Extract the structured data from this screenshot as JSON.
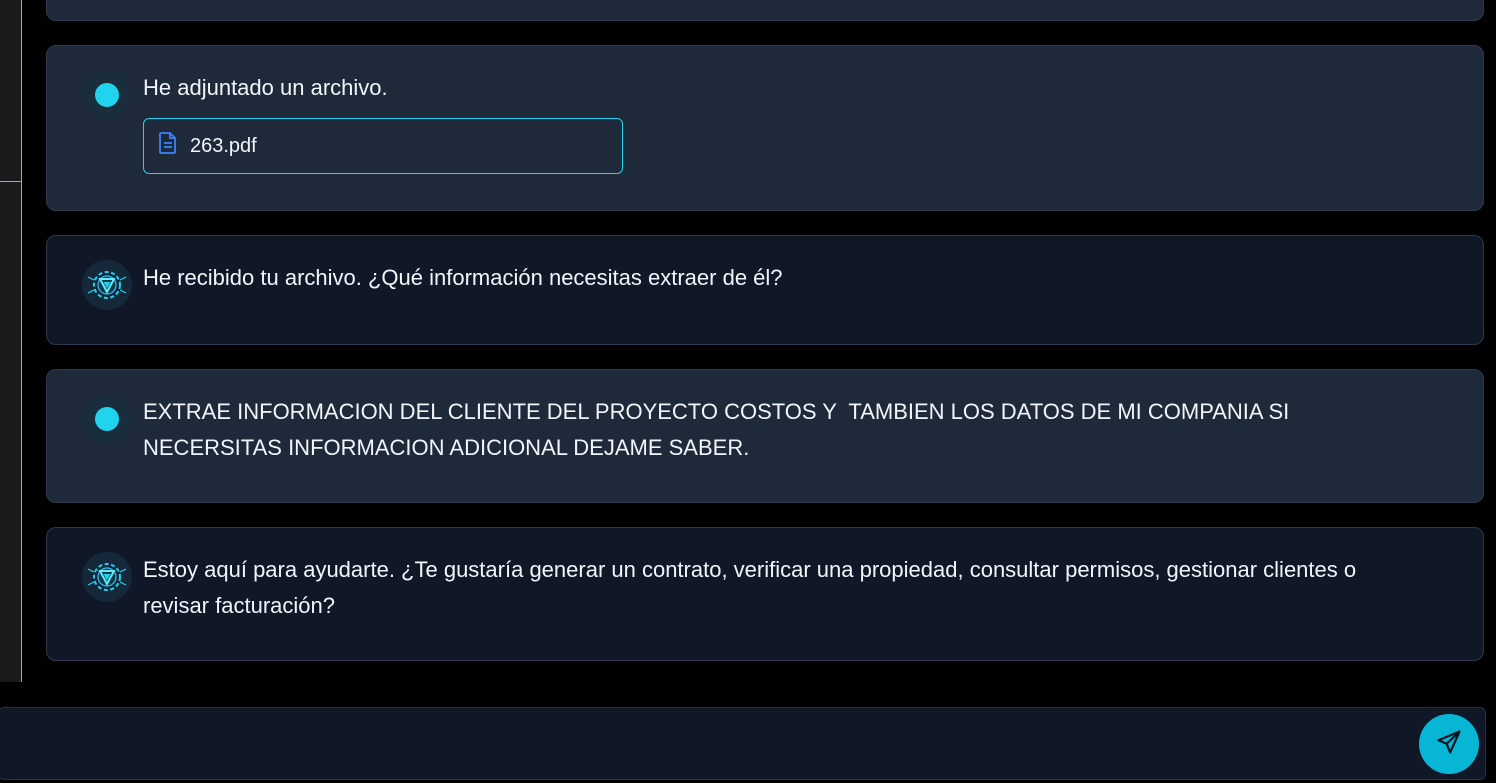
{
  "messages": [
    {
      "role": "user",
      "text": "He adjuntado un archivo.",
      "attachment": {
        "name": "263.pdf"
      }
    },
    {
      "role": "assistant",
      "text": "He recibido tu archivo. ¿Qué información necesitas extraer de él?"
    },
    {
      "role": "user",
      "text": "EXTRAE INFORMACION DEL CLIENTE DEL PROYECTO COSTOS Y  TAMBIEN LOS DATOS DE MI COMPANIA SI NECERSITAS INFORMACION ADICIONAL DEJAME SABER."
    },
    {
      "role": "assistant",
      "text": "Estoy aquí para ayudarte. ¿Te gustaría generar un contrato, verificar una propiedad, consultar permisos, gestionar clientes o revisar facturación?"
    }
  ],
  "composer": {
    "value": "",
    "placeholder": ""
  },
  "icons": {
    "send": "send-icon",
    "file": "file-text-icon",
    "assistant_avatar": "assistant-logo-icon"
  },
  "colors": {
    "accent": "#22d3ee",
    "user_bubble": "#1e2939",
    "bot_bubble": "#101828",
    "send_button": "#06b6d4"
  }
}
